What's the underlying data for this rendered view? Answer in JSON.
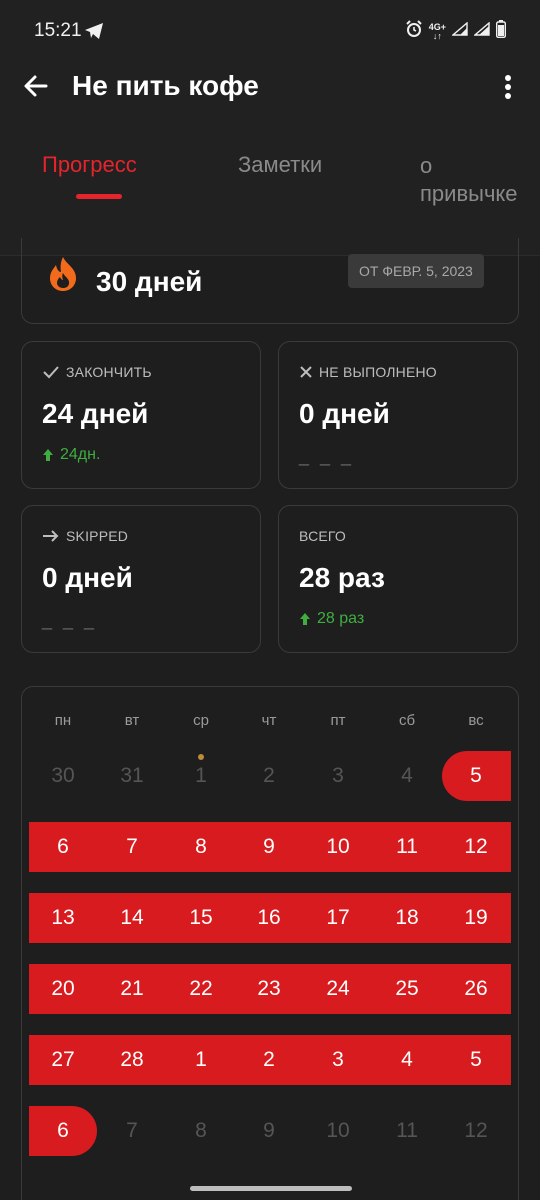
{
  "status_bar": {
    "time": "15:21",
    "network_top": "4G+",
    "network_bottom": "↓↑"
  },
  "header": {
    "title": "Не пить кофе"
  },
  "tabs": [
    {
      "label": "Прогресс",
      "active": true
    },
    {
      "label": "Заметки",
      "active": false
    },
    {
      "label": "о привычке",
      "active": false
    }
  ],
  "streak": {
    "value": "30 дней",
    "since": "ОТ ФЕВР. 5, 2023"
  },
  "stats": {
    "completed": {
      "label": "ЗАКОНЧИТЬ",
      "value": "24 дней",
      "delta": "24дн."
    },
    "failed": {
      "label": "НЕ ВЫПОЛНЕНО",
      "value": "0 дней",
      "delta": "_ _ _"
    },
    "skipped": {
      "label": "SKIPPED",
      "value": "0 дней",
      "delta": "_ _ _"
    },
    "total": {
      "label": "ВСЕГО",
      "value": "28 раз",
      "delta": "28 раз"
    }
  },
  "calendar": {
    "weekdays": [
      "пн",
      "вт",
      "ср",
      "чт",
      "пт",
      "сб",
      "вс"
    ],
    "weeks": [
      [
        {
          "d": "30",
          "done": false,
          "dim": true
        },
        {
          "d": "31",
          "done": false,
          "dim": true
        },
        {
          "d": "1",
          "done": false,
          "dim": true
        },
        {
          "d": "2",
          "done": false,
          "dim": true
        },
        {
          "d": "3",
          "done": false,
          "dim": true
        },
        {
          "d": "4",
          "done": false,
          "dim": true
        },
        {
          "d": "5",
          "done": true,
          "dim": false
        }
      ],
      [
        {
          "d": "6",
          "done": true,
          "dim": false
        },
        {
          "d": "7",
          "done": true,
          "dim": false
        },
        {
          "d": "8",
          "done": true,
          "dim": false
        },
        {
          "d": "9",
          "done": true,
          "dim": false
        },
        {
          "d": "10",
          "done": true,
          "dim": false
        },
        {
          "d": "11",
          "done": true,
          "dim": false
        },
        {
          "d": "12",
          "done": true,
          "dim": false
        }
      ],
      [
        {
          "d": "13",
          "done": true,
          "dim": false
        },
        {
          "d": "14",
          "done": true,
          "dim": false
        },
        {
          "d": "15",
          "done": true,
          "dim": false
        },
        {
          "d": "16",
          "done": true,
          "dim": false
        },
        {
          "d": "17",
          "done": true,
          "dim": false
        },
        {
          "d": "18",
          "done": true,
          "dim": false
        },
        {
          "d": "19",
          "done": true,
          "dim": false
        }
      ],
      [
        {
          "d": "20",
          "done": true,
          "dim": false
        },
        {
          "d": "21",
          "done": true,
          "dim": false
        },
        {
          "d": "22",
          "done": true,
          "dim": false
        },
        {
          "d": "23",
          "done": true,
          "dim": false
        },
        {
          "d": "24",
          "done": true,
          "dim": false
        },
        {
          "d": "25",
          "done": true,
          "dim": false
        },
        {
          "d": "26",
          "done": true,
          "dim": false
        }
      ],
      [
        {
          "d": "27",
          "done": true,
          "dim": false
        },
        {
          "d": "28",
          "done": true,
          "dim": false
        },
        {
          "d": "1",
          "done": true,
          "dim": false
        },
        {
          "d": "2",
          "done": true,
          "dim": false
        },
        {
          "d": "3",
          "done": true,
          "dim": false
        },
        {
          "d": "4",
          "done": true,
          "dim": false
        },
        {
          "d": "5",
          "done": true,
          "dim": false
        }
      ],
      [
        {
          "d": "6",
          "done": true,
          "dim": false
        },
        {
          "d": "7",
          "done": false,
          "dim": true
        },
        {
          "d": "8",
          "done": false,
          "dim": true
        },
        {
          "d": "9",
          "done": false,
          "dim": true
        },
        {
          "d": "10",
          "done": false,
          "dim": true
        },
        {
          "d": "11",
          "done": false,
          "dim": true
        },
        {
          "d": "12",
          "done": false,
          "dim": true
        }
      ]
    ]
  },
  "colors": {
    "accent": "#e5242b",
    "done_fill": "#d81b1e",
    "positive": "#3fae3f",
    "background": "#1e1e1e"
  }
}
